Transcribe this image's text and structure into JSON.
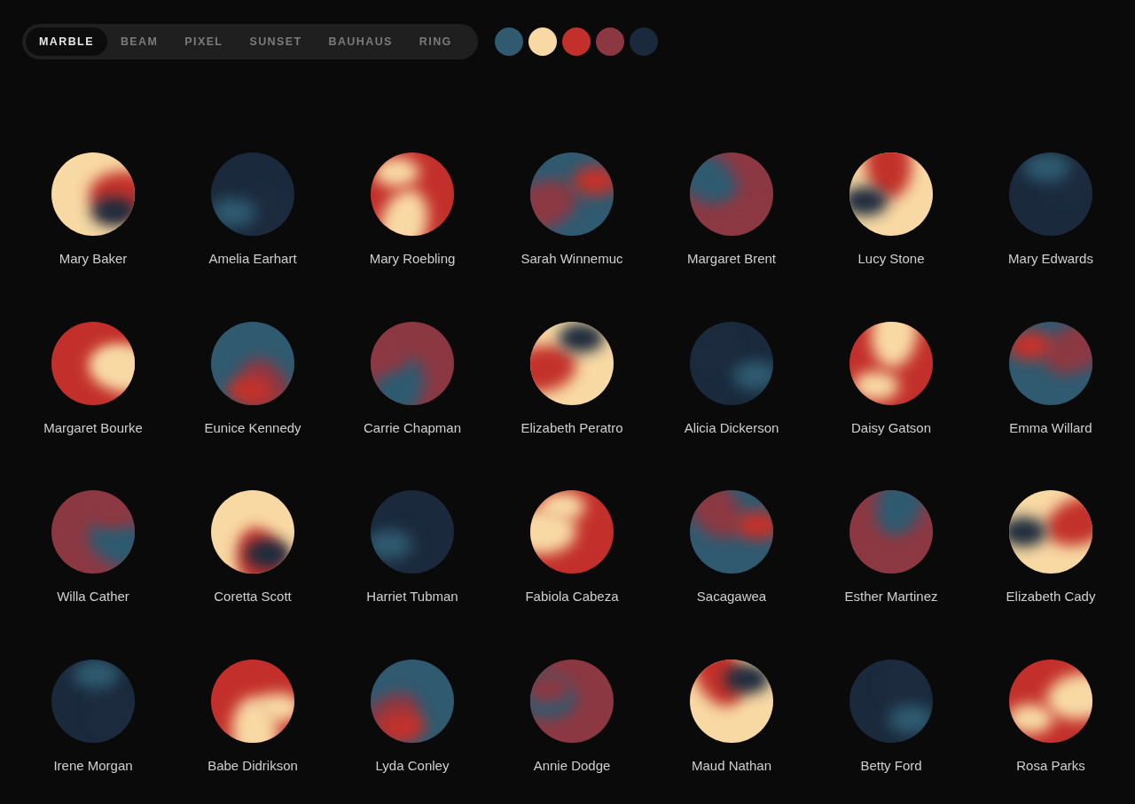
{
  "tabs": [
    {
      "label": "MARBLE",
      "selected": true
    },
    {
      "label": "BEAM",
      "selected": false
    },
    {
      "label": "PIXEL",
      "selected": false
    },
    {
      "label": "SUNSET",
      "selected": false
    },
    {
      "label": "BAUHAUS",
      "selected": false
    },
    {
      "label": "RING",
      "selected": false
    }
  ],
  "palette": [
    {
      "color": "#2f5a70"
    },
    {
      "color": "#f8d9a4"
    },
    {
      "color": "#c3302b"
    },
    {
      "color": "#8c3842"
    },
    {
      "color": "#1a2a3c"
    }
  ],
  "avatars": [
    {
      "name": "Mary Baker"
    },
    {
      "name": "Amelia Earhart"
    },
    {
      "name": "Mary Roebling"
    },
    {
      "name": "Sarah Winnemuc"
    },
    {
      "name": "Margaret Brent"
    },
    {
      "name": "Lucy Stone"
    },
    {
      "name": "Mary Edwards"
    },
    {
      "name": "Margaret Bourke"
    },
    {
      "name": "Eunice Kennedy"
    },
    {
      "name": "Carrie Chapman"
    },
    {
      "name": "Elizabeth Peratro"
    },
    {
      "name": "Alicia Dickerson"
    },
    {
      "name": "Daisy Gatson"
    },
    {
      "name": "Emma Willard"
    },
    {
      "name": "Willa Cather"
    },
    {
      "name": "Coretta Scott"
    },
    {
      "name": "Harriet Tubman"
    },
    {
      "name": "Fabiola Cabeza"
    },
    {
      "name": "Sacagawea"
    },
    {
      "name": "Esther Martinez"
    },
    {
      "name": "Elizabeth Cady"
    },
    {
      "name": "Irene Morgan"
    },
    {
      "name": "Babe Didrikson"
    },
    {
      "name": "Lyda Conley"
    },
    {
      "name": "Annie Dodge"
    },
    {
      "name": "Maud Nathan"
    },
    {
      "name": "Betty Ford"
    },
    {
      "name": "Rosa Parks"
    }
  ]
}
